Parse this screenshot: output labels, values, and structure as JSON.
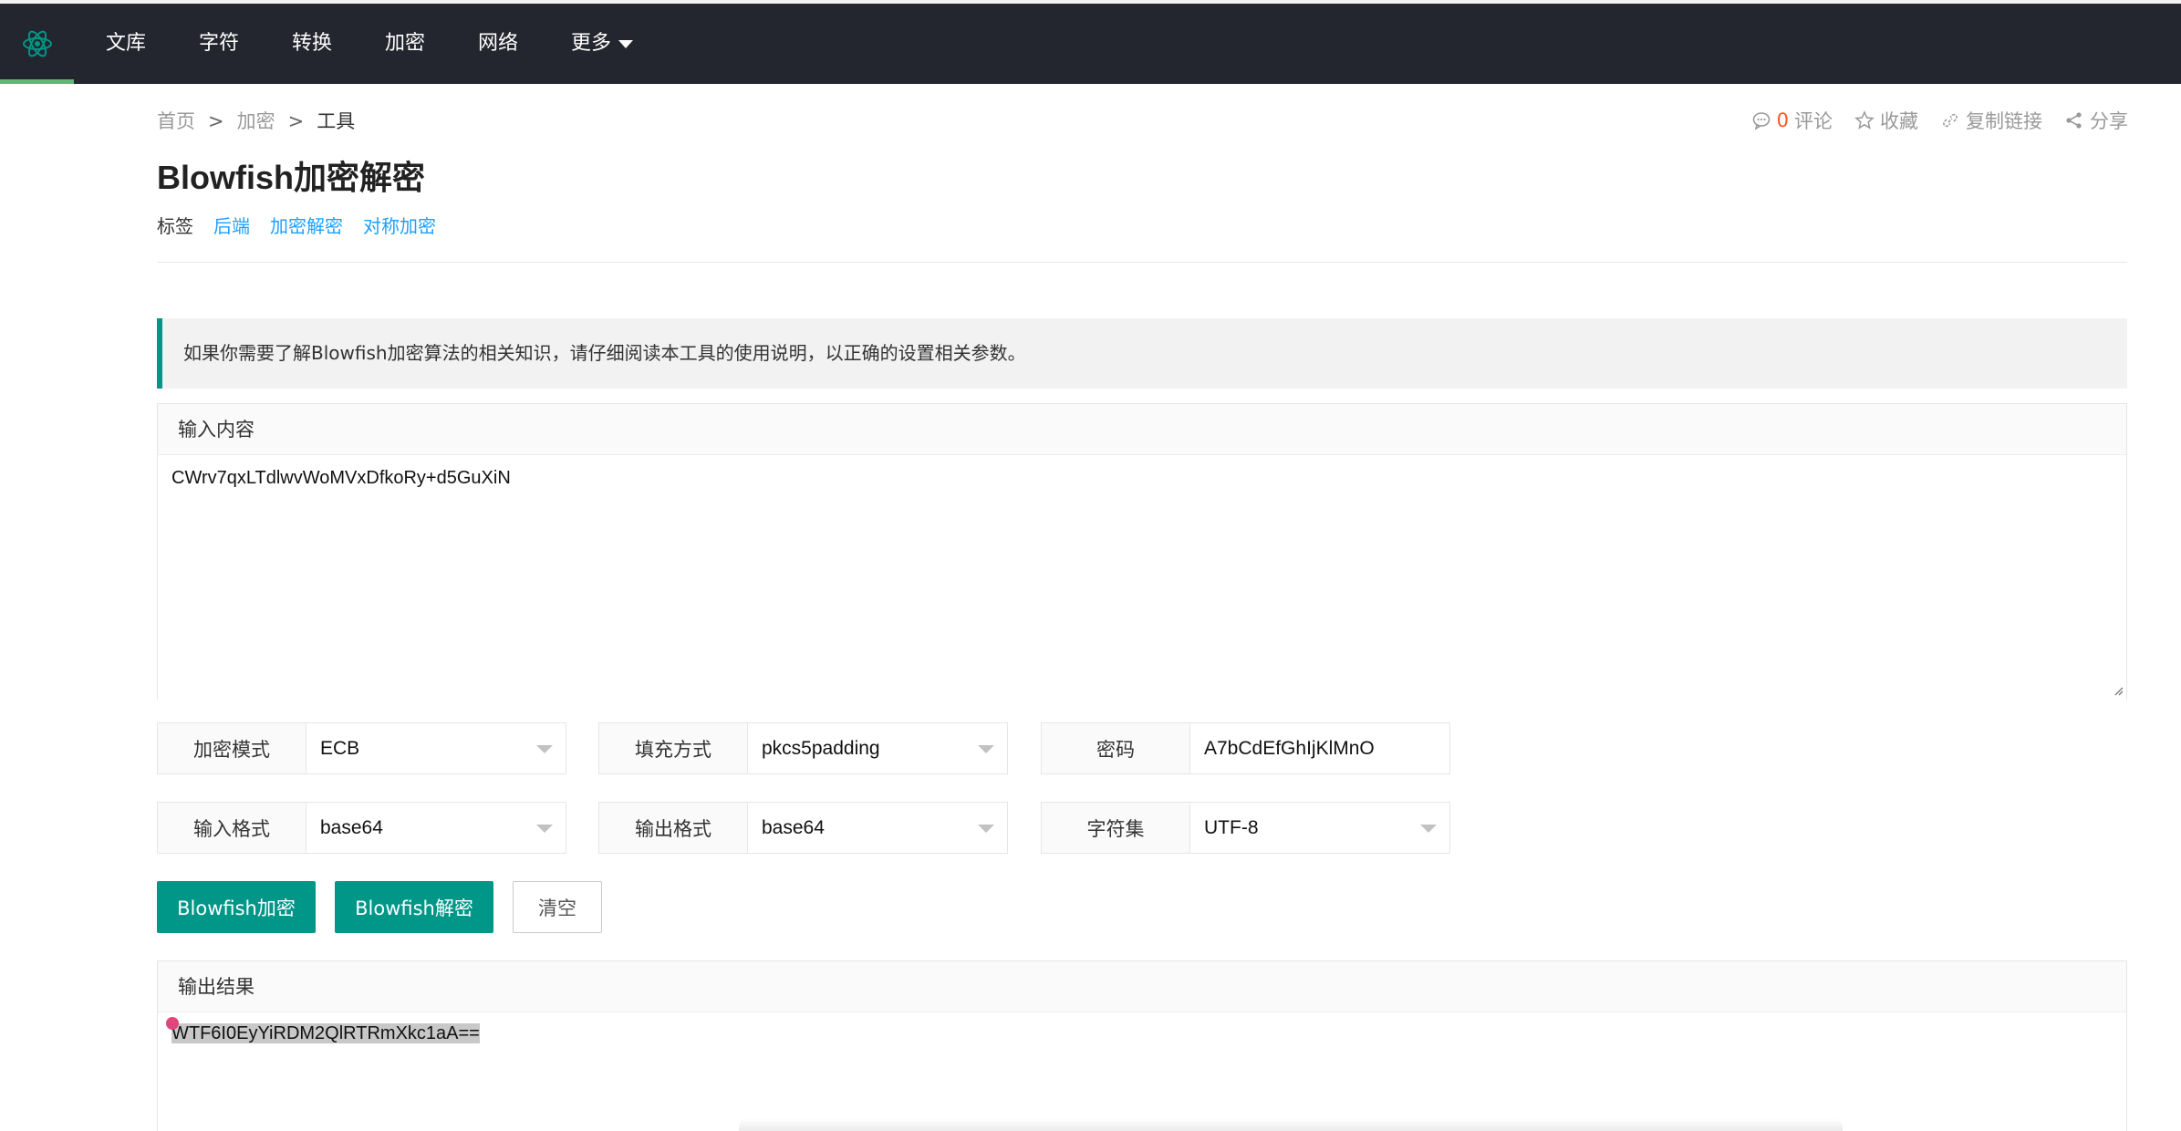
{
  "nav": {
    "logo": "atom-logo-icon",
    "items": [
      "文库",
      "字符",
      "转换",
      "加密",
      "网络",
      "更多"
    ]
  },
  "breadcrumb": {
    "items": [
      "首页",
      "加密",
      "工具"
    ],
    "separator": ">"
  },
  "actions": {
    "comment_count": "0",
    "comment_label": "评论",
    "favorite_label": "收藏",
    "copy_link_label": "复制链接",
    "share_label": "分享"
  },
  "page": {
    "title": "Blowfish加密解密",
    "tags_label": "标签",
    "tags": [
      "后端",
      "加密解密",
      "对称加密"
    ]
  },
  "notice": "如果你需要了解Blowfish加密算法的相关知识，请仔细阅读本工具的使用说明，以正确的设置相关参数。",
  "input": {
    "header": "输入内容",
    "value": "CWrv7qxLTdlwvWoMVxDfkoRy+d5GuXiN"
  },
  "settings": {
    "mode": {
      "label": "加密模式",
      "value": "ECB"
    },
    "padding": {
      "label": "填充方式",
      "value": "pkcs5padding"
    },
    "password": {
      "label": "密码",
      "value": "A7bCdEfGhIjKlMnO"
    },
    "input_format": {
      "label": "输入格式",
      "value": "base64"
    },
    "output_format": {
      "label": "输出格式",
      "value": "base64"
    },
    "charset": {
      "label": "字符集",
      "value": "UTF-8"
    }
  },
  "buttons": {
    "encrypt": "Blowfish加密",
    "decrypt": "Blowfish解密",
    "clear": "清空"
  },
  "output": {
    "header": "输出结果",
    "value": "WTF6I0EyYiRDM2QlRTRmXkc1aA=="
  },
  "colors": {
    "nav_bg": "#23262e",
    "accent": "#009688",
    "link": "#1e9fff",
    "active_bar": "#5fb878"
  }
}
